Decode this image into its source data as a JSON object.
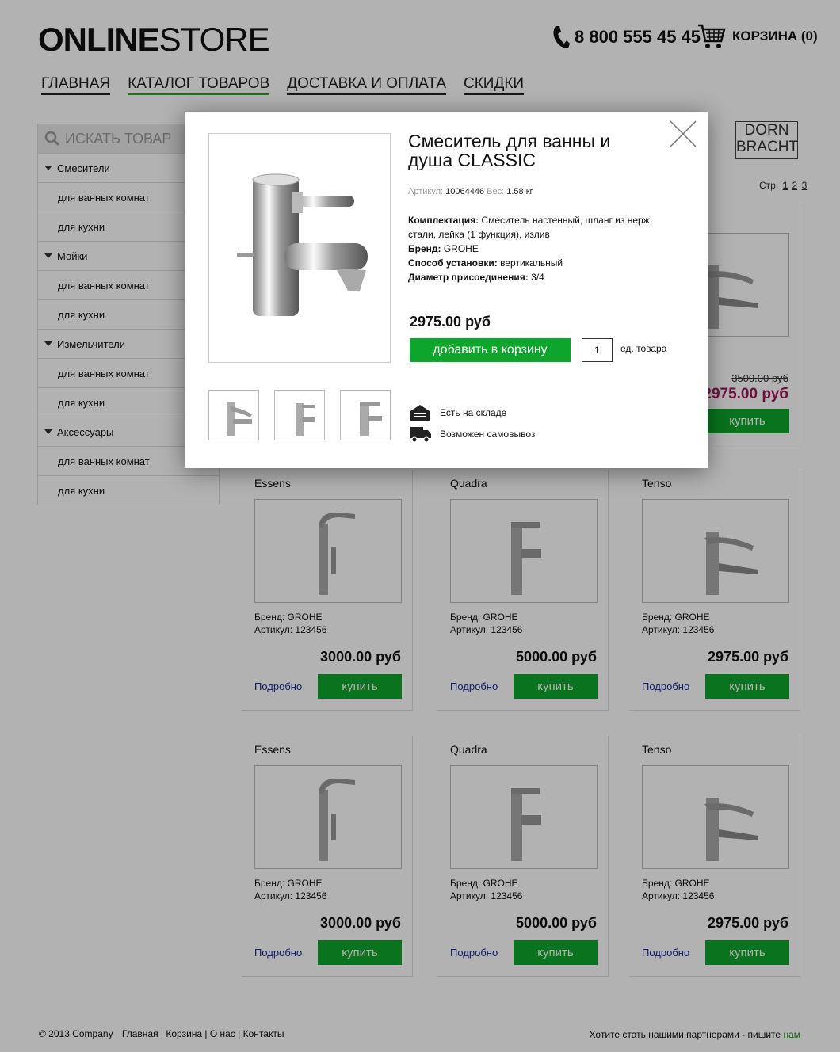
{
  "header": {
    "logo_bold": "ONLINE",
    "logo_light": "STORE",
    "phone": "8 800 555 45 45",
    "cart_label": "КОРЗИНА (0)"
  },
  "nav": [
    {
      "label": "ГЛАВНАЯ"
    },
    {
      "label": "КАТАЛОГ ТОВАРОВ",
      "active": true
    },
    {
      "label": "ДОСТАВКА И ОПЛАТА"
    },
    {
      "label": "СКИДКИ"
    }
  ],
  "search": {
    "placeholder": "ИСКАТЬ ТОВАР"
  },
  "sidebar": [
    {
      "label": "Смесители",
      "type": "top"
    },
    {
      "label": "для ванных комнат",
      "type": "sub"
    },
    {
      "label": "для кухни",
      "type": "sub"
    },
    {
      "label": "Мойки",
      "type": "top"
    },
    {
      "label": "для ванных комнат",
      "type": "sub"
    },
    {
      "label": "для кухни",
      "type": "sub"
    },
    {
      "label": "Измельчители",
      "type": "top"
    },
    {
      "label": "для ванных комнат",
      "type": "sub"
    },
    {
      "label": "для кухни",
      "type": "sub"
    },
    {
      "label": "Аксессуары",
      "type": "top"
    },
    {
      "label": "для ванных комнат",
      "type": "sub"
    },
    {
      "label": "для кухни",
      "type": "sub"
    }
  ],
  "brand_logo": {
    "line1": "DORN",
    "line2": "BRACHT"
  },
  "pager": {
    "label": "Стр.",
    "pages": [
      "1",
      "2",
      "3"
    ]
  },
  "peek": {
    "old_price": "3500.00 руб",
    "price": "2975.00 руб",
    "buy": "купить"
  },
  "products": [
    {
      "name": "Essens",
      "brand": "Бренд:  GROHE",
      "article": "Артикул: 123456",
      "price": "3000.00 руб",
      "more": "Подробно",
      "buy": "купить"
    },
    {
      "name": "Quadra",
      "brand": "Бренд:  GROHE",
      "article": "Артикул: 123456",
      "price": "5000.00 руб",
      "more": "Подробно",
      "buy": "купить"
    },
    {
      "name": "Tenso",
      "brand": "Бренд:  GROHE",
      "article": "Артикул: 123456",
      "price": "2975.00 руб",
      "more": "Подробно",
      "buy": "купить"
    },
    {
      "name": "Essens",
      "brand": "Бренд:  GROHE",
      "article": "Артикул: 123456",
      "price": "3000.00 руб",
      "more": "Подробно",
      "buy": "купить"
    },
    {
      "name": "Quadra",
      "brand": "Бренд:  GROHE",
      "article": "Артикул: 123456",
      "price": "5000.00 руб",
      "more": "Подробно",
      "buy": "купить"
    },
    {
      "name": "Tenso",
      "brand": "Бренд:  GROHE",
      "article": "Артикул: 123456",
      "price": "2975.00 руб",
      "more": "Подробно",
      "buy": "купить"
    }
  ],
  "footer": {
    "copyright": "© 2013 Company",
    "links": "Главная | Корзина | О нас | Контакты",
    "partner_text": "Хотите стать нашими партнерами - пишите ",
    "partner_link": "нам"
  },
  "modal": {
    "title": "Смеситель для ванны и душа CLASSIC",
    "article_label": "Артикул:",
    "article_value": "10064446",
    "weight_label": "Вес:",
    "weight_value": "1.58 кг",
    "specs": [
      {
        "key": "Комплектация:",
        "value": "Смеситель настенный, шланг из нерж. стали, лейка (1 функция), излив"
      },
      {
        "key": "Бренд:",
        "value": "GROHE"
      },
      {
        "key": "Способ установки:",
        "value": "вертикальный"
      },
      {
        "key": "Диаметр присоединения:",
        "value": "3/4"
      }
    ],
    "price": "2975.00 руб",
    "add_to_cart": "добавить в корзину",
    "quantity": "1",
    "unit": "ед. товара",
    "in_stock": "Есть на складе",
    "pickup": "Возможен самовывоз"
  },
  "colors": {
    "accent_green": "#0ea52c",
    "sale_price": "#a3175f",
    "link_blue": "#1a2a9a"
  }
}
